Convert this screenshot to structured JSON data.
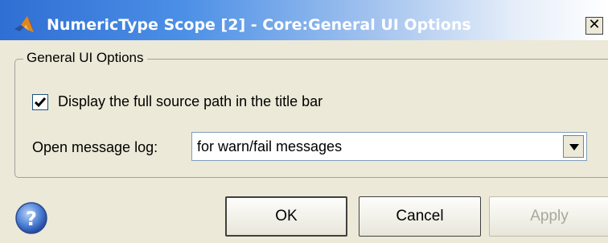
{
  "window": {
    "title": "NumericType Scope [2] - Core:General UI Options",
    "close_label": "✕"
  },
  "group": {
    "legend": "General UI Options"
  },
  "options": {
    "show_full_path_label": "Display the full source path in the title bar",
    "show_full_path_checked": true,
    "message_log_label": "Open message log:",
    "message_log_value": "for warn/fail messages"
  },
  "buttons": {
    "ok": "OK",
    "cancel": "Cancel",
    "apply": "Apply"
  },
  "colors": {
    "titlebar_start": "#2f6ed3",
    "dialog_bg": "#ece9d8",
    "disabled_text": "#a8a899"
  },
  "icons": {
    "app": "matlab-logo-icon",
    "help": "help-question-icon"
  }
}
